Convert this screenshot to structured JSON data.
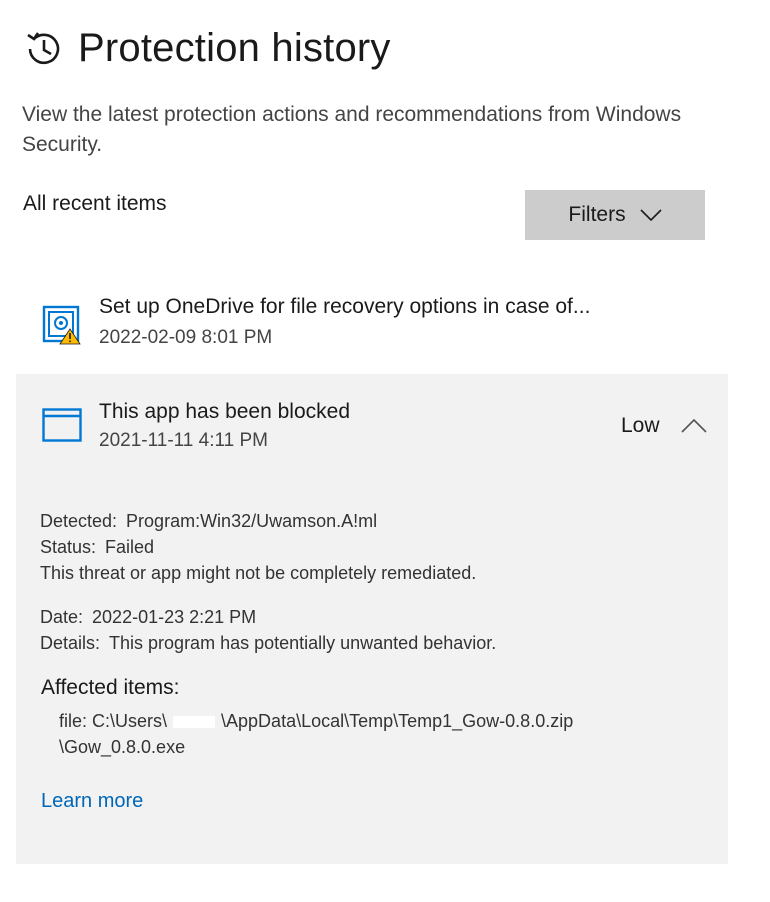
{
  "header": {
    "title": "Protection history",
    "title_icon": "history-clock-icon",
    "subtitle": "View the latest protection actions and recommendations from Windows Security."
  },
  "list": {
    "section_label": "All recent items",
    "filters_label": "Filters"
  },
  "items": [
    {
      "icon": "shield-folder-warning-icon",
      "title": "Set up OneDrive for file recovery options in case of...",
      "date": "2022-02-09 8:01 PM"
    },
    {
      "icon": "app-window-icon",
      "title": "This app has been blocked",
      "date": "2021-11-11 4:11 PM",
      "severity": "Low",
      "details": {
        "detected_label": "Detected:",
        "detected_value": "Program:Win32/Uwamson.A!ml",
        "status_label": "Status:",
        "status_value": "Failed",
        "status_note": "This threat or app might not be completely remediated.",
        "date_label": "Date:",
        "date_value": "2022-01-23 2:21 PM",
        "details_label": "Details:",
        "details_value": "This program has potentially unwanted behavior.",
        "affected_heading": "Affected items:",
        "path_prefix": "file: C:\\Users\\",
        "path_suffix": "\\AppData\\Local\\Temp\\Temp1_Gow-0.8.0.zip",
        "path_line2": "\\Gow_0.8.0.exe",
        "learn_more": "Learn more"
      }
    }
  ],
  "colors": {
    "accent_blue": "#0067b8",
    "icon_blue": "#0078d4",
    "warning_yellow": "#ffb900",
    "expanded_bg": "#f2f2f2",
    "button_bg": "#cccccc"
  }
}
